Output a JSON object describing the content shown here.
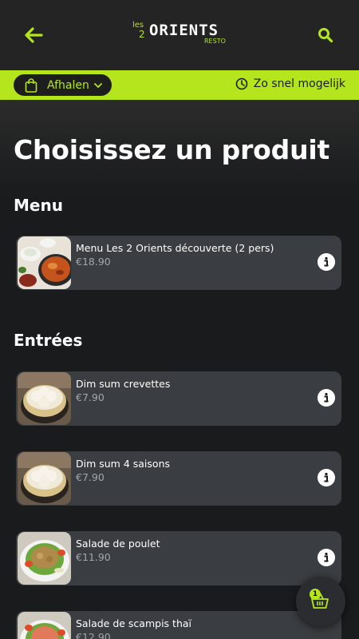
{
  "header": {
    "logo": {
      "les": "les",
      "two": "2",
      "main": "ORIENTS",
      "resto": "RESTO"
    },
    "back_icon": "arrow-left-icon",
    "search_icon": "search-icon"
  },
  "order_bar": {
    "mode_label": "Afhalen",
    "time_label": "Zo snel mogelijk"
  },
  "page_title": "Choisissez un produit",
  "sections": [
    {
      "title": "Menu",
      "items": [
        {
          "name": "Menu Les 2 Orients découverte (2 pers)",
          "price": "€18.90",
          "image": "curry-dish"
        }
      ]
    },
    {
      "title": "Entrées",
      "items": [
        {
          "name": "Dim sum crevettes",
          "price": "€7.90",
          "image": "dim-sum-steamer"
        },
        {
          "name": "Dim sum 4 saisons",
          "price": "€7.90",
          "image": "dim-sum-steamer"
        },
        {
          "name": "Salade de poulet",
          "price": "€11.90",
          "image": "salad-bowl"
        },
        {
          "name": "Salade de scampis thaï",
          "price": "€12.90",
          "image": "salad-bowl"
        }
      ]
    }
  ],
  "cart": {
    "count": "1",
    "icon": "basket-icon"
  },
  "colors": {
    "accent": "#b5e61d",
    "card": "#3a3d41",
    "background": "#1a1b1d",
    "header": "#242424"
  }
}
